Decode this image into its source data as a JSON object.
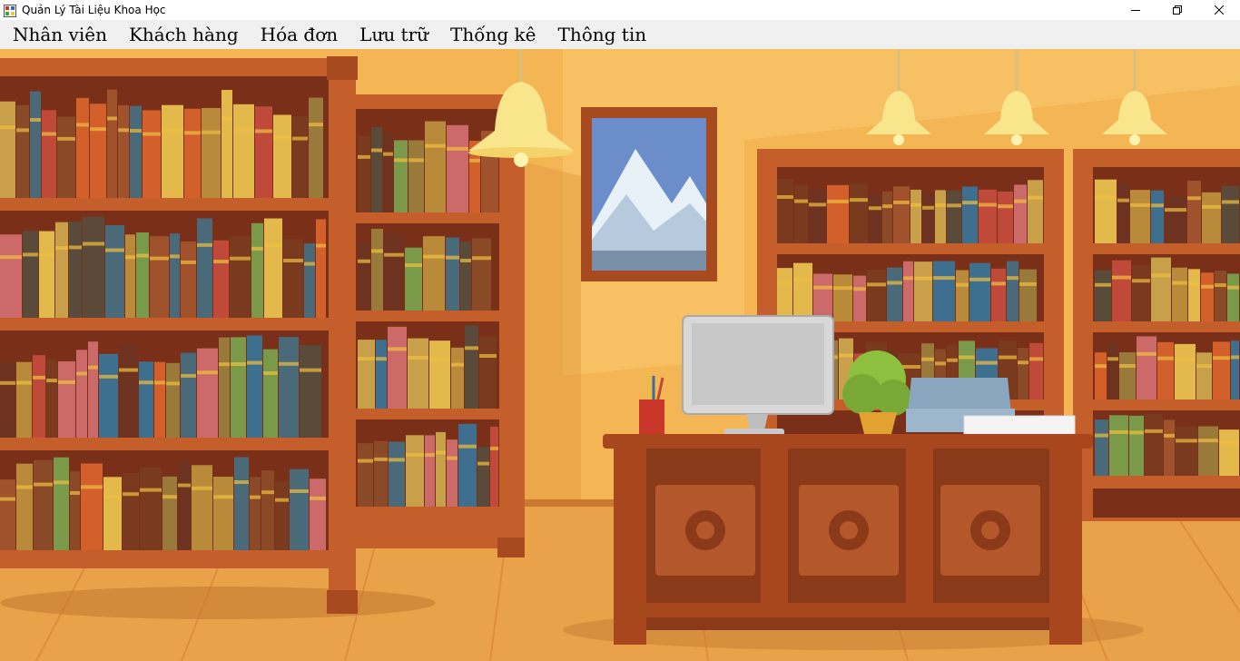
{
  "window": {
    "title": "Quản Lý Tài Liệu Khoa Học",
    "controls": [
      "minimize-icon",
      "restore-icon",
      "close-icon"
    ]
  },
  "menu": {
    "items": [
      {
        "label": "Nhân viên"
      },
      {
        "label": "Khách hàng"
      },
      {
        "label": "Hóa đơn"
      },
      {
        "label": "Lưu trữ"
      },
      {
        "label": "Thống kê"
      },
      {
        "label": "Thông tin"
      }
    ]
  },
  "scene": {
    "colors": {
      "wall": "#f4b554",
      "wall_light": "#f8c96e",
      "floor": "#e9a24a",
      "shelf": "#c45e2a",
      "shelf_dark": "#7a3018",
      "desk": "#a8461e",
      "lamp": "#f9e58c"
    },
    "book_colors": [
      "#7a3a1e",
      "#c9a04a",
      "#d35f2a",
      "#e2b94a",
      "#6d3320",
      "#b88a3a",
      "#cc6a6a",
      "#8a4a28",
      "#4a6a7a",
      "#9a7a3a",
      "#7a9a4a",
      "#c04a3a",
      "#5a4a3a",
      "#3f6f8f",
      "#a0522d"
    ]
  }
}
